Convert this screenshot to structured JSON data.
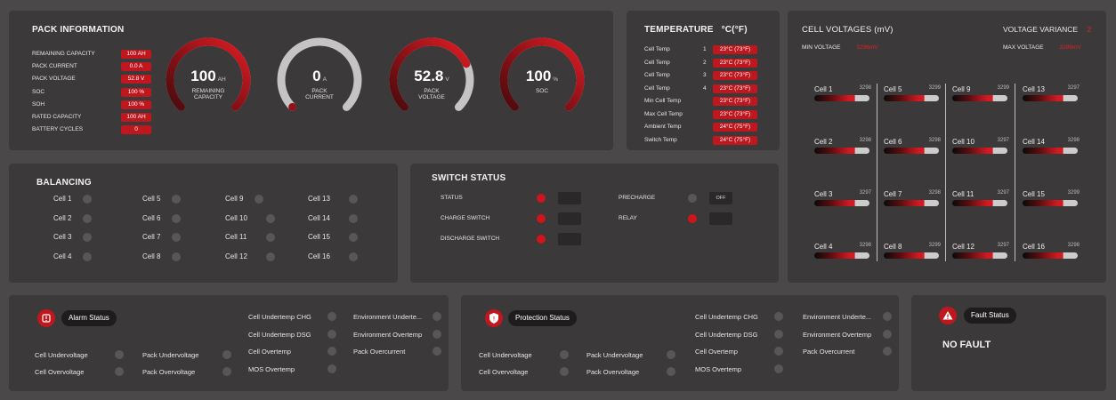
{
  "pack": {
    "title": "PACK INFORMATION",
    "rows": [
      {
        "label": "REMAINING CAPACITY",
        "value": "100  AH"
      },
      {
        "label": "PACK CURRENT",
        "value": "0.0  A"
      },
      {
        "label": "PACK VOLTAGE",
        "value": "52.8  V"
      },
      {
        "label": "SOC",
        "value": "100  %"
      },
      {
        "label": "SOH",
        "value": "100  %"
      },
      {
        "label": "RATED CAPACITY",
        "value": "100  AH"
      },
      {
        "label": "BATTERY CYCLES",
        "value": "0"
      }
    ],
    "gauges": [
      {
        "value": "100",
        "unit": "AH",
        "label": "REMAINING CAPACITY",
        "fill": 1.0
      },
      {
        "value": "0",
        "unit": "A",
        "label": "PACK CURRENT",
        "fill": 0.0
      },
      {
        "value": "52.8",
        "unit": "V",
        "label": "PACK VOLTAGE",
        "fill": 0.74
      },
      {
        "value": "100",
        "unit": "%",
        "label": "SOC",
        "fill": 1.0
      }
    ]
  },
  "temperature": {
    "title": "TEMPERATURE",
    "unit": "°C(°F)",
    "rows": [
      {
        "label": "Cell Temp",
        "index": "1",
        "value": "23°C (73°F)"
      },
      {
        "label": "Cell Temp",
        "index": "2",
        "value": "23°C (73°F)"
      },
      {
        "label": "Cell Temp",
        "index": "3",
        "value": "23°C (73°F)"
      },
      {
        "label": "Cell Temp",
        "index": "4",
        "value": "23°C (73°F)"
      },
      {
        "label": "Min Cell Temp",
        "index": "",
        "value": "23°C (73°F)"
      },
      {
        "label": "Max Cell Temp",
        "index": "",
        "value": "23°C (73°F)"
      },
      {
        "label": "Ambient Temp",
        "index": "",
        "value": "24°C (75°F)"
      },
      {
        "label": "Switch Temp",
        "index": "",
        "value": "24°C (75°F)"
      }
    ]
  },
  "cell_voltages": {
    "title": "CELL VOLTAGES (mV)",
    "variance_label": "VOLTAGE VARIANCE",
    "variance_value": "2",
    "min_label": "MIN VOLTAGE",
    "min_value": "3296mV",
    "max_label": "MAX VOLTAGE",
    "max_value": "3299mV",
    "columns": [
      [
        {
          "name": "Cell 1",
          "mv": "3298"
        },
        {
          "name": "Cell 2",
          "mv": "3298"
        },
        {
          "name": "Cell 3",
          "mv": "3297"
        },
        {
          "name": "Cell 4",
          "mv": "3298"
        }
      ],
      [
        {
          "name": "Cell 5",
          "mv": "3299"
        },
        {
          "name": "Cell 6",
          "mv": "3298"
        },
        {
          "name": "Cell 7",
          "mv": "3298"
        },
        {
          "name": "Cell 8",
          "mv": "3299"
        }
      ],
      [
        {
          "name": "Cell 9",
          "mv": "3299"
        },
        {
          "name": "Cell 10",
          "mv": "3297"
        },
        {
          "name": "Cell 11",
          "mv": "3297"
        },
        {
          "name": "Cell 12",
          "mv": "3297"
        }
      ],
      [
        {
          "name": "Cell 13",
          "mv": "3297"
        },
        {
          "name": "Cell 14",
          "mv": "3298"
        },
        {
          "name": "Cell 15",
          "mv": "3299"
        },
        {
          "name": "Cell 16",
          "mv": "3298"
        }
      ]
    ]
  },
  "balancing": {
    "title": "BALANCING",
    "columns": [
      [
        "Cell 1",
        "Cell 2",
        "Cell 3",
        "Cell 4"
      ],
      [
        "Cell 5",
        "Cell 6",
        "Cell 7",
        "Cell 8"
      ],
      [
        "Cell 9",
        "Cell 10",
        "Cell 11",
        "Cell 12"
      ],
      [
        "Cell 13",
        "Cell 14",
        "Cell 15",
        "Cell 16"
      ]
    ]
  },
  "switch_status": {
    "title": "SWITCH STATUS",
    "status": "STATUS",
    "charge": "CHARGE SWITCH",
    "discharge": "DISCHARGE SWITCH",
    "precharge": "PRECHARGE",
    "precharge_value": "OFF",
    "relay": "RELAY"
  },
  "alarm": {
    "title": "Alarm Status",
    "col1": [
      "Cell Undervoltage",
      "Cell Overvoltage"
    ],
    "col2": [
      "Pack Undervoltage",
      "Pack Overvoltage"
    ],
    "col3": [
      "Cell Undertemp CHG",
      "Cell Undertemp DSG",
      "Cell Overtemp",
      "MOS Overtemp"
    ],
    "col4": [
      "Environment Underte...",
      "Environment Overtemp",
      "Pack Overcurrent"
    ]
  },
  "protection": {
    "title": "Protection Status",
    "col1": [
      "Cell Undervoltage",
      "Cell Overvoltage"
    ],
    "col2": [
      "Pack Undervoltage",
      "Pack Overvoltage"
    ],
    "col3": [
      "Cell Undertemp CHG",
      "Cell Undertemp DSG",
      "Cell Overtemp",
      "MOS Overtemp"
    ],
    "col4": [
      "Environment Underte...",
      "Environment Overtemp",
      "Pack Overcurrent"
    ]
  },
  "fault": {
    "title": "Fault Status",
    "value": "NO FAULT"
  },
  "colors": {
    "accent": "#c0161e",
    "panel": "#3b3939",
    "background": "#4a4848"
  }
}
